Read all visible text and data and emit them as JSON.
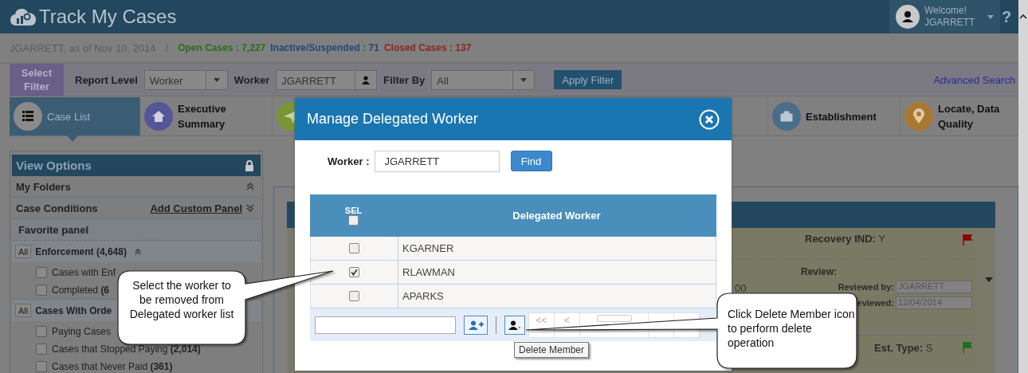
{
  "app": {
    "title": "Track My Cases",
    "greeting": "Welcome!",
    "user": "JGARRETT",
    "help": "?"
  },
  "status": {
    "user_date": "JGARRETT, as of Nov 10, 2014",
    "separator": "/",
    "counts": [
      {
        "label": "Open Cases : 7,227",
        "color": "#2e6b1e"
      },
      {
        "label": "Inactive/Suspended : 71",
        "color": "#25487a"
      },
      {
        "label": "Closed Cases : 137",
        "color": "#8b2525"
      }
    ]
  },
  "filter": {
    "select_filter": "Select Filter",
    "report_level_label": "Report Level",
    "report_level": "Worker",
    "worker_label": "Worker",
    "worker": "JGARRETT",
    "filter_by_label": "Filter By",
    "filter_by": "All",
    "apply": "Apply Filter",
    "advanced_search": "Advanced Search"
  },
  "nav_tabs": [
    {
      "label": "Case List",
      "selected": true,
      "color": "#8a8a8a"
    },
    {
      "label": "Executive Summary",
      "selected": false,
      "color": "#55559a"
    },
    {
      "selected": false,
      "color": "#7a9535"
    },
    {
      "label": "Establishment",
      "selected": false,
      "color": "#4a6d8a"
    },
    {
      "label": "Locate, Data Quality",
      "selected": false,
      "color": "#a87832"
    }
  ],
  "sidebar": {
    "title": "View Options",
    "sections": [
      {
        "label": "My Folders",
        "expanded": true
      },
      {
        "label": "Case Conditions",
        "link": "Add Custom Panel",
        "expanded": false
      }
    ],
    "favorite_panel": "Favorite panel",
    "groups": [
      {
        "all": "All",
        "title": "Enforcement (4,648)",
        "expanded": true,
        "items": [
          {
            "label": "Cases with Enf",
            "checked": false
          },
          {
            "label": "Completed **(6**",
            "checked": false
          }
        ]
      },
      {
        "all": "All",
        "title": "Cases With Orde",
        "items": [
          {
            "label": "Paying Cases",
            "checked": false
          },
          {
            "label": "Cases that Stopped Paying **(2,014)**",
            "checked": false
          },
          {
            "label": "Cases that Never Paid **(361)**",
            "checked": false
          }
        ]
      }
    ]
  },
  "case_panel": {
    "recovery_label": "Recovery IND:",
    "recovery": "Y",
    "recovery_flag": {
      "color": "#8b0000"
    },
    "amount": "00",
    "review_label": "Review:",
    "reviewed_by_label": "Reviewed by:",
    "reviewed_by": "JGARRETT",
    "reviewed_label": "eviewed:",
    "reviewed": "12/04/2014",
    "est_type_label": "Est. Type:",
    "est_type": "S",
    "est_flag": {
      "color": "#1f6f1f"
    }
  },
  "modal": {
    "title": "Manage Delegated Worker",
    "worker_label": "Worker :",
    "worker": "JGARRETT",
    "find": "Find",
    "sel_header": "SEL",
    "all_checked": false,
    "column": "Delegated Worker",
    "rows": [
      {
        "name": "KGARNER",
        "checked": false
      },
      {
        "name": "RLAWMAN",
        "checked": true
      },
      {
        "name": "APARKS",
        "checked": false
      }
    ],
    "pager": [
      "<<",
      "<"
    ],
    "tooltip": "Delete Member"
  },
  "callouts": [
    "Select the worker to be removed from Delegated worker list",
    "Click Delete Member icon to perform delete operation"
  ]
}
